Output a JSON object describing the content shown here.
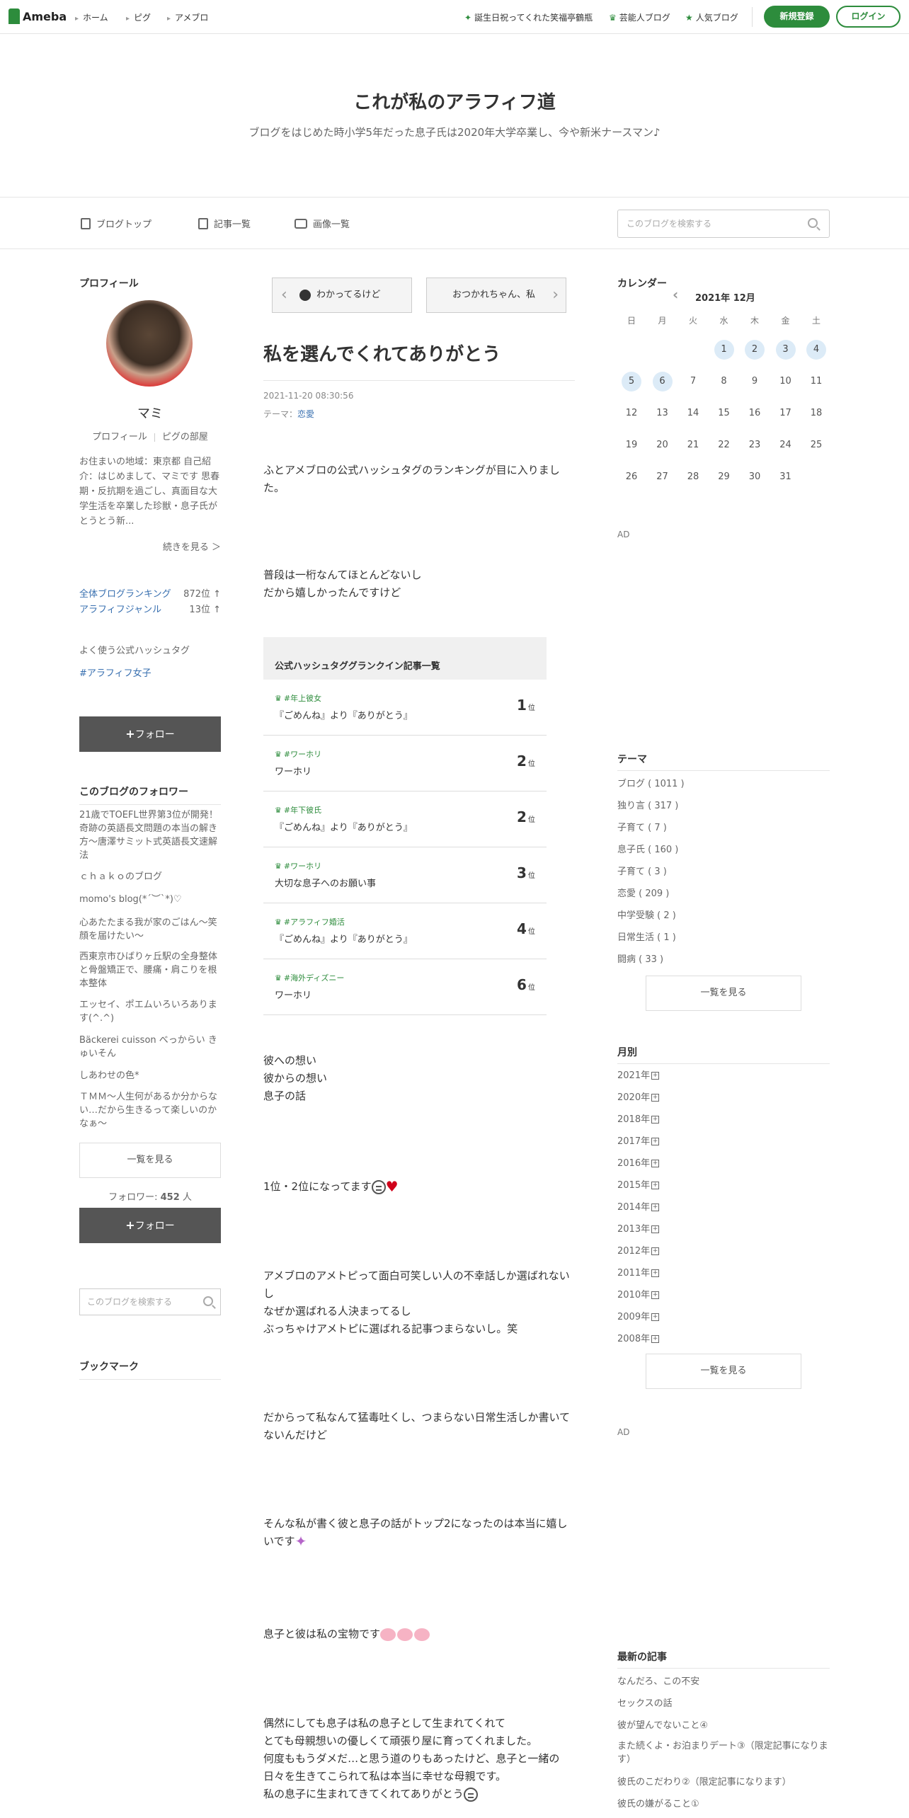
{
  "topnav": {
    "logo": "Ameba",
    "crumbs": [
      "ホーム",
      "ピグ",
      "アメブロ"
    ],
    "right_links": [
      "誕生日祝ってくれた笑福亭鶴瓶",
      "芸能人ブログ",
      "人気ブログ"
    ],
    "signup": "新規登録",
    "login": "ログイン"
  },
  "header": {
    "title": "これが私のアラフィフ道",
    "description": "ブログをはじめた時小学5年だった息子氏は2020年大学卒業し、今や新米ナースマン♪"
  },
  "blognav": {
    "items": [
      "ブログトップ",
      "記事一覧",
      "画像一覧"
    ],
    "search_placeholder": "このブログを検索する"
  },
  "profile": {
    "title": "プロフィール",
    "name": "マミ",
    "link_profile": "プロフィール",
    "link_pig": "ピグの部屋",
    "text": "お住まいの地域：東京都 自己紹介：はじめまして、マミです 思春期・反抗期を過ごし、真面目な大学生活を卒業した珍獣・息子氏がとうとう新...",
    "read_more": "続きを見る ＞",
    "ranks": [
      {
        "label": "全体ブログランキング",
        "value": "872位 ↑"
      },
      {
        "label": "アラフィフジャンル",
        "value": "13位 ↑"
      }
    ],
    "hashtag_title": "よく使う公式ハッシュタグ",
    "hashtag": "#アラフィフ女子",
    "follow": "フォロー"
  },
  "followers": {
    "title": "このブログのフォロワー",
    "items": [
      "21歳でTOEFL世界第3位が開発！奇跡の英語長文問題の本当の解き方〜唐澤サミット式英語長文速解法",
      "ｃｈａｋｏのブログ",
      "momo's blog(*´︶`*)♡",
      "心あたたまる我が家のごはん〜笑顔を届けたい〜",
      "西東京市ひばりヶ丘駅の全身整体と骨盤矯正で、腰痛・肩こりを根本整体",
      "エッセイ、ポエムいろいろあります(^.^)",
      "Bäckerei cuisson べっからい きゅいそん",
      "しあわせの色*",
      "ＴＭＭ～人生何があるか分からない…だから生きるって楽しいのかなぁ～"
    ],
    "see_all": "一覧を見る",
    "count_label": "フォロワー: ",
    "count": "452",
    "count_unit": " 人",
    "follow": "フォロー"
  },
  "left_search_placeholder": "このブログを検索する",
  "bookmark_title": "ブックマーク",
  "post": {
    "prev": "わかってるけど",
    "next": "おつかれちゃん、私",
    "title": "私を選んでくれてありがとう",
    "date": "2021-11-20 08:30:56",
    "theme_label": "テーマ：",
    "theme": "恋愛",
    "p1": "ふとアメブロの公式ハッシュタグのランキングが目に入りました。",
    "p2a": "普段は一桁なんてほとんどないし",
    "p2b": "だから嬉しかったんですけど",
    "table_title": "公式ハッシュタググランクイン記事一覧",
    "table": [
      {
        "tag": "#年上彼女",
        "title": "『ごめんね』より『ありがとう』",
        "rank": "1",
        "unit": "位"
      },
      {
        "tag": "#ワーホリ",
        "title": "ワーホリ",
        "rank": "2",
        "unit": "位"
      },
      {
        "tag": "#年下彼氏",
        "title": "『ごめんね』より『ありがとう』",
        "rank": "2",
        "unit": "位"
      },
      {
        "tag": "#ワーホリ",
        "title": "大切な息子へのお願い事",
        "rank": "3",
        "unit": "位"
      },
      {
        "tag": "#アラフィフ婚活",
        "title": "『ごめんね』より『ありがとう』",
        "rank": "4",
        "unit": "位"
      },
      {
        "tag": "#海外ディズニー",
        "title": "ワーホリ",
        "rank": "6",
        "unit": "位"
      }
    ],
    "p3a": "彼への想い",
    "p3b": "彼からの想い",
    "p3c": "息子の話",
    "p4": "1位・2位になってます",
    "p5a": "アメブロのアメトピって面白可笑しい人の不幸話しか選ばれないし",
    "p5b": "なぜか選ばれる人決まってるし",
    "p5c": "ぶっちゃけアメトピに選ばれる記事つまらないし。笑",
    "p6": "だからって私なんて猛毒吐くし、つまらない日常生活しか書いてないんだけど",
    "p7": "そんな私が書く彼と息子の話がトップ2になったのは本当に嬉しいです",
    "p8": "息子と彼は私の宝物です",
    "p9a": "偶然にしても息子は私の息子として生まれてくれて",
    "p9b": "とても母親想いの優しくて頑張り屋に育ってくれました。",
    "p9c": "何度ももうダメだ…と思う道のりもあったけど、息子と一緒の日々を生きてこられて私は本当に幸せな母親です。",
    "p9d": "私の息子に生まれてきてくれてありがとう"
  },
  "calendar": {
    "title": "カレンダー",
    "month": "2021年 12月",
    "weekdays": [
      "日",
      "月",
      "火",
      "水",
      "木",
      "金",
      "土"
    ],
    "highlighted_days": [
      1,
      2,
      3,
      4,
      5,
      6
    ]
  },
  "ad_label": "AD",
  "themes": {
    "title": "テーマ",
    "items": [
      "ブログ ( 1011 )",
      "独り言 ( 317 )",
      "子育て ( 7 )",
      "息子氏 ( 160 )",
      "子育て ( 3 )",
      "恋愛 ( 209 )",
      "中学受験 ( 2 )",
      "日常生活 ( 1 )",
      "闘病 ( 33 )"
    ],
    "see_all": "一覧を見る"
  },
  "monthly": {
    "title": "月別",
    "items": [
      "2021年",
      "2020年",
      "2018年",
      "2017年",
      "2016年",
      "2015年",
      "2014年",
      "2013年",
      "2012年",
      "2011年",
      "2010年",
      "2009年",
      "2008年"
    ],
    "see_all": "一覧を見る"
  },
  "recent": {
    "title": "最新の記事",
    "items": [
      "なんだろ、この不安",
      "セックスの話",
      "彼が望んでないこと④",
      "また続くよ・お泊まりデート③（限定記事になります）",
      "彼氏のこだわり②（限定記事になります）",
      "彼氏の嫌がること①"
    ]
  },
  "colors": {
    "brand": "#2d8c3c",
    "link": "#3970b0",
    "highlight": "#dcebf7"
  }
}
